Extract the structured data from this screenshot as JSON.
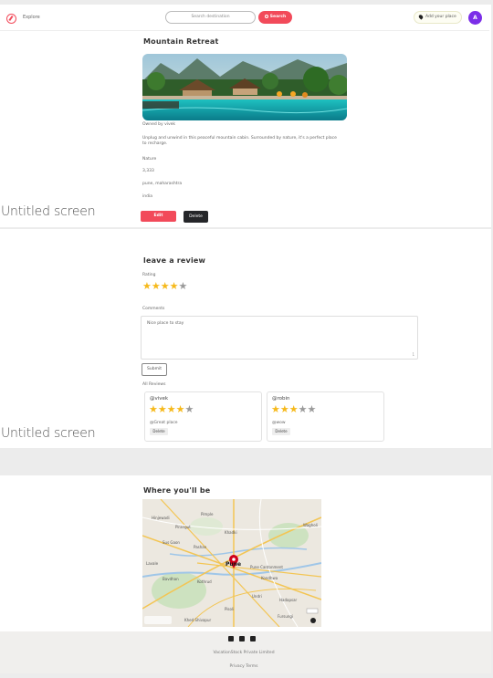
{
  "screens": {
    "label1": "Untitled screen",
    "label2": "Untitled screen"
  },
  "nav": {
    "explore": "Explore",
    "search_placeholder": "Search destination",
    "search_button": "Search",
    "add_place": "Add your place",
    "avatar_initial": "A"
  },
  "listing": {
    "title": "Mountain Retreat",
    "owner": "Owned by vivek",
    "description": "Unplug and unwind in this peaceful mountain cabin. Surrounded by nature, it's a perfect place to recharge.",
    "category": "Nature",
    "price": "3,333",
    "location": "pune, maharashtra",
    "country": "india",
    "edit_button": "Edit",
    "delete_button": "Delete"
  },
  "review_form": {
    "heading": "leave a review",
    "rating_label": "Rating",
    "rating": 4,
    "max_rating": 5,
    "comments_label": "Comments",
    "comment_value": "Nice place to stay",
    "char_counter": "1",
    "submit_button": "Submit",
    "all_reviews_label": "All Reviews"
  },
  "reviews": [
    {
      "author": "@vivek",
      "rating": 4,
      "comment": "@Great place",
      "delete": "Delete"
    },
    {
      "author": "@robin",
      "rating": 3,
      "comment": "@wow",
      "delete": "Delete"
    }
  ],
  "map_section": {
    "heading": "Where you'll be",
    "city": "Pune",
    "places": [
      "Hinjewadi",
      "Sus Gaon",
      "Lavale",
      "Bavdhan",
      "Kothrud",
      "Wagholi",
      "Hadapsar",
      "Undri",
      "Fursungi",
      "Pisoli",
      "Khed Shivapur",
      "Pirangut",
      "Khadki",
      "Kondhwa",
      "Pimple",
      "Pashan",
      "Pune Cantonment"
    ],
    "colors": {
      "pin": "#d0021b",
      "road": "#f3c553",
      "water": "#9fc6e8",
      "green": "#cde2c0"
    }
  },
  "footer": {
    "company": "VacationStock Private Limited",
    "links": "Privacy  Terms"
  }
}
